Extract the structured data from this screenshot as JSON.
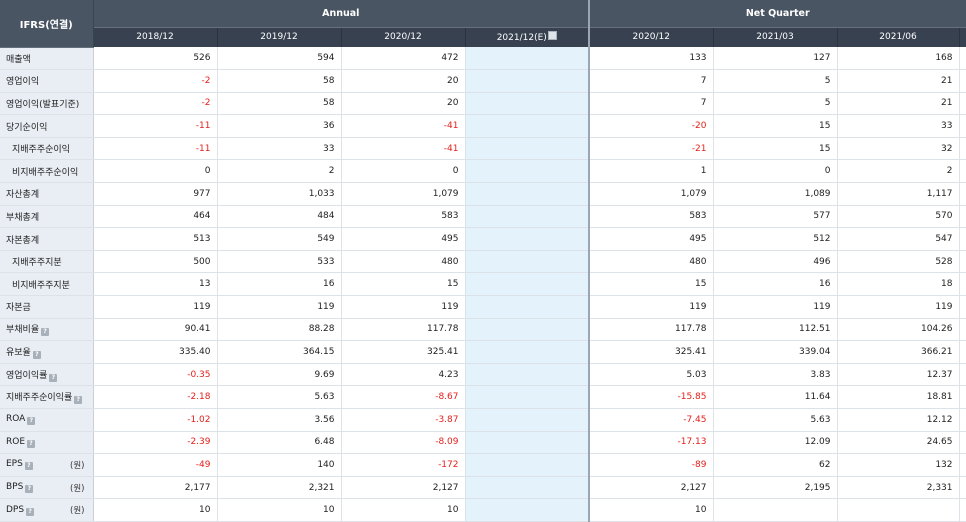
{
  "header": {
    "corner": "IFRS(연결)",
    "groups": [
      "Annual",
      "Net Quarter"
    ],
    "annual_cols": [
      "2018/12",
      "2019/12",
      "2020/12",
      "2021/12(E)"
    ],
    "quarter_cols": [
      "2020/12",
      "2021/03",
      "2021/06"
    ]
  },
  "rows": [
    {
      "label": "매출액",
      "indent": false,
      "help": false,
      "unit": "",
      "values": [
        "526",
        "594",
        "472",
        "",
        "133",
        "127",
        "168"
      ]
    },
    {
      "label": "영업이익",
      "indent": false,
      "help": false,
      "unit": "",
      "values": [
        "-2",
        "58",
        "20",
        "",
        "7",
        "5",
        "21"
      ]
    },
    {
      "label": "영업이익(발표기준)",
      "indent": false,
      "help": false,
      "unit": "",
      "values": [
        "-2",
        "58",
        "20",
        "",
        "7",
        "5",
        "21"
      ]
    },
    {
      "label": "당기순이익",
      "indent": false,
      "help": false,
      "unit": "",
      "values": [
        "-11",
        "36",
        "-41",
        "",
        "-20",
        "15",
        "33"
      ]
    },
    {
      "label": "지배주주순이익",
      "indent": true,
      "help": false,
      "unit": "",
      "values": [
        "-11",
        "33",
        "-41",
        "",
        "-21",
        "15",
        "32"
      ]
    },
    {
      "label": "비지배주주순이익",
      "indent": true,
      "help": false,
      "unit": "",
      "values": [
        "0",
        "2",
        "0",
        "",
        "1",
        "0",
        "2"
      ]
    },
    {
      "label": "자산총계",
      "indent": false,
      "help": false,
      "unit": "",
      "values": [
        "977",
        "1,033",
        "1,079",
        "",
        "1,079",
        "1,089",
        "1,117"
      ]
    },
    {
      "label": "부채총계",
      "indent": false,
      "help": false,
      "unit": "",
      "values": [
        "464",
        "484",
        "583",
        "",
        "583",
        "577",
        "570"
      ]
    },
    {
      "label": "자본총계",
      "indent": false,
      "help": false,
      "unit": "",
      "values": [
        "513",
        "549",
        "495",
        "",
        "495",
        "512",
        "547"
      ]
    },
    {
      "label": "지배주주지분",
      "indent": true,
      "help": false,
      "unit": "",
      "values": [
        "500",
        "533",
        "480",
        "",
        "480",
        "496",
        "528"
      ]
    },
    {
      "label": "비지배주주지분",
      "indent": true,
      "help": false,
      "unit": "",
      "values": [
        "13",
        "16",
        "15",
        "",
        "15",
        "16",
        "18"
      ]
    },
    {
      "label": "자본금",
      "indent": false,
      "help": false,
      "unit": "",
      "values": [
        "119",
        "119",
        "119",
        "",
        "119",
        "119",
        "119"
      ]
    },
    {
      "label": "부채비율",
      "indent": false,
      "help": true,
      "unit": "",
      "values": [
        "90.41",
        "88.28",
        "117.78",
        "",
        "117.78",
        "112.51",
        "104.26"
      ]
    },
    {
      "label": "유보율",
      "indent": false,
      "help": true,
      "unit": "",
      "values": [
        "335.40",
        "364.15",
        "325.41",
        "",
        "325.41",
        "339.04",
        "366.21"
      ]
    },
    {
      "label": "영업이익률",
      "indent": false,
      "help": true,
      "unit": "",
      "values": [
        "-0.35",
        "9.69",
        "4.23",
        "",
        "5.03",
        "3.83",
        "12.37"
      ]
    },
    {
      "label": "지배주주순이익률",
      "indent": false,
      "help": true,
      "unit": "",
      "values": [
        "-2.18",
        "5.63",
        "-8.67",
        "",
        "-15.85",
        "11.64",
        "18.81"
      ]
    },
    {
      "label": "ROA",
      "indent": false,
      "help": true,
      "unit": "",
      "values": [
        "-1.02",
        "3.56",
        "-3.87",
        "",
        "-7.45",
        "5.63",
        "12.12"
      ]
    },
    {
      "label": "ROE",
      "indent": false,
      "help": true,
      "unit": "",
      "values": [
        "-2.39",
        "6.48",
        "-8.09",
        "",
        "-17.13",
        "12.09",
        "24.65"
      ]
    },
    {
      "label": "EPS",
      "indent": false,
      "help": true,
      "unit": "(원)",
      "values": [
        "-49",
        "140",
        "-172",
        "",
        "-89",
        "62",
        "132"
      ]
    },
    {
      "label": "BPS",
      "indent": false,
      "help": true,
      "unit": "(원)",
      "values": [
        "2,177",
        "2,321",
        "2,127",
        "",
        "2,127",
        "2,195",
        "2,331"
      ]
    },
    {
      "label": "DPS",
      "indent": false,
      "help": true,
      "unit": "(원)",
      "values": [
        "10",
        "10",
        "10",
        "",
        "10",
        "",
        ""
      ]
    }
  ],
  "colors": {
    "header": "#4a5563",
    "subheader": "#384150",
    "label_bg": "#e9eef5",
    "estimate_bg": "#e3f2fb",
    "negative": "#e4201c"
  }
}
